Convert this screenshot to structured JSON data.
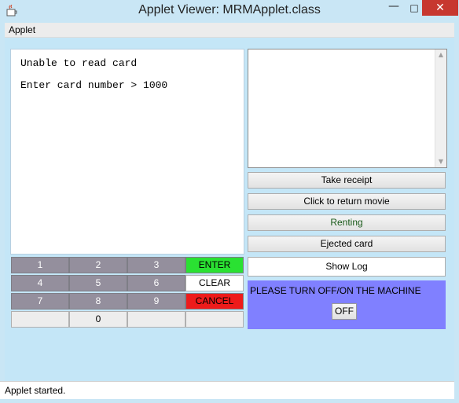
{
  "window": {
    "title": "Applet Viewer: MRMApplet.class",
    "controls": {
      "minimize": "—",
      "maximize": "□",
      "close": "✕"
    }
  },
  "menu": {
    "items": [
      "Applet"
    ]
  },
  "screen": {
    "line1": "Unable to read card",
    "line2": "Enter card number > 1000"
  },
  "log": {
    "text": ""
  },
  "buttons": {
    "take_receipt": "Take receipt",
    "return_movie": "Click to return movie",
    "renting": "Renting",
    "ejected_card": "Ejected card",
    "show_log": "Show Log"
  },
  "keypad": {
    "k1": "1",
    "k2": "2",
    "k3": "3",
    "enter": "ENTER",
    "k4": "4",
    "k5": "5",
    "k6": "6",
    "clear": "CLEAR",
    "k7": "7",
    "k8": "8",
    "k9": "9",
    "cancel": "CANCEL",
    "k0": "0"
  },
  "notice": {
    "message": "PLEASE TURN OFF/ON THE MACHINE",
    "off_button": "OFF"
  },
  "status": "Applet started.",
  "colors": {
    "background": "#c4e6f7",
    "keypad_key": "#948f9d",
    "enter": "#2ae132",
    "cancel": "#ee1b1b",
    "notice": "#8080ff",
    "renting_text": "#1a5a1a"
  }
}
